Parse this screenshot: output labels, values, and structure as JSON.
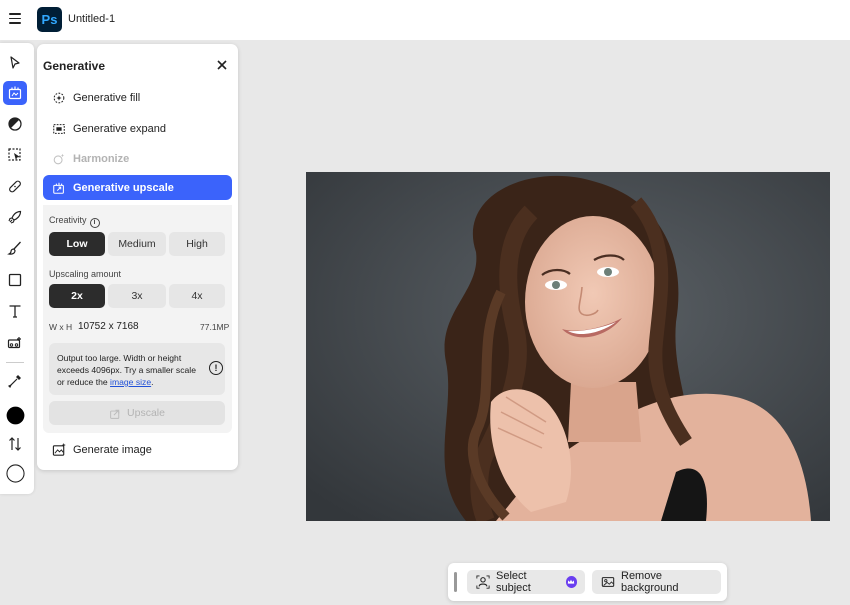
{
  "app": {
    "logo_text": "Ps",
    "document_title": "Untitled-1"
  },
  "toolbar": {
    "tools": [
      {
        "name": "select-tool",
        "icon": "arrow-pointer-icon"
      },
      {
        "name": "generative-tool",
        "icon": "generative-icon",
        "active": true
      },
      {
        "name": "adjustments-tool",
        "icon": "adjust-icon"
      },
      {
        "name": "selection-tool",
        "icon": "marquee-icon"
      },
      {
        "name": "retouch-tool",
        "icon": "bandage-icon"
      },
      {
        "name": "quick-actions-tool",
        "icon": "rocket-icon"
      },
      {
        "name": "brush-tool",
        "icon": "brush-icon"
      },
      {
        "name": "shape-tool",
        "icon": "rectangle-icon"
      },
      {
        "name": "type-tool",
        "icon": "type-icon"
      },
      {
        "name": "add-image-tool",
        "icon": "image-add-icon"
      },
      {
        "name": "eyedropper-tool",
        "icon": "eyedropper-icon"
      }
    ],
    "foreground_color": "#000000",
    "background_color": "#ffffff"
  },
  "panel": {
    "title": "Generative",
    "items": [
      {
        "label": "Generative fill",
        "state": "normal"
      },
      {
        "label": "Generative expand",
        "state": "normal"
      },
      {
        "label": "Harmonize",
        "state": "disabled"
      },
      {
        "label": "Generative upscale",
        "state": "selected"
      }
    ],
    "creativity": {
      "label": "Creativity",
      "options": [
        "Low",
        "Medium",
        "High"
      ],
      "selected": "Low"
    },
    "upscaling": {
      "label": "Upscaling amount",
      "options": [
        "2x",
        "3x",
        "4x"
      ],
      "selected": "2x"
    },
    "dimensions": {
      "label": "W x H",
      "value": "10752 x 7168",
      "megapixels": "77.1MP"
    },
    "warning": {
      "text": "Output too large. Width or height exceeds 4096px. Try a smaller scale or reduce the",
      "link": "image size",
      "suffix": "."
    },
    "upscale_button": "Upscale",
    "generate_image": "Generate image"
  },
  "taskbar": {
    "select_subject": "Select subject",
    "remove_background": "Remove background"
  },
  "colors": {
    "accent": "#3b63fb",
    "canvas_bg": "#e8e8e8",
    "ps_logo_bg": "#001e36",
    "ps_logo_fg": "#31a8ff",
    "premium": "#6a3ef0"
  }
}
